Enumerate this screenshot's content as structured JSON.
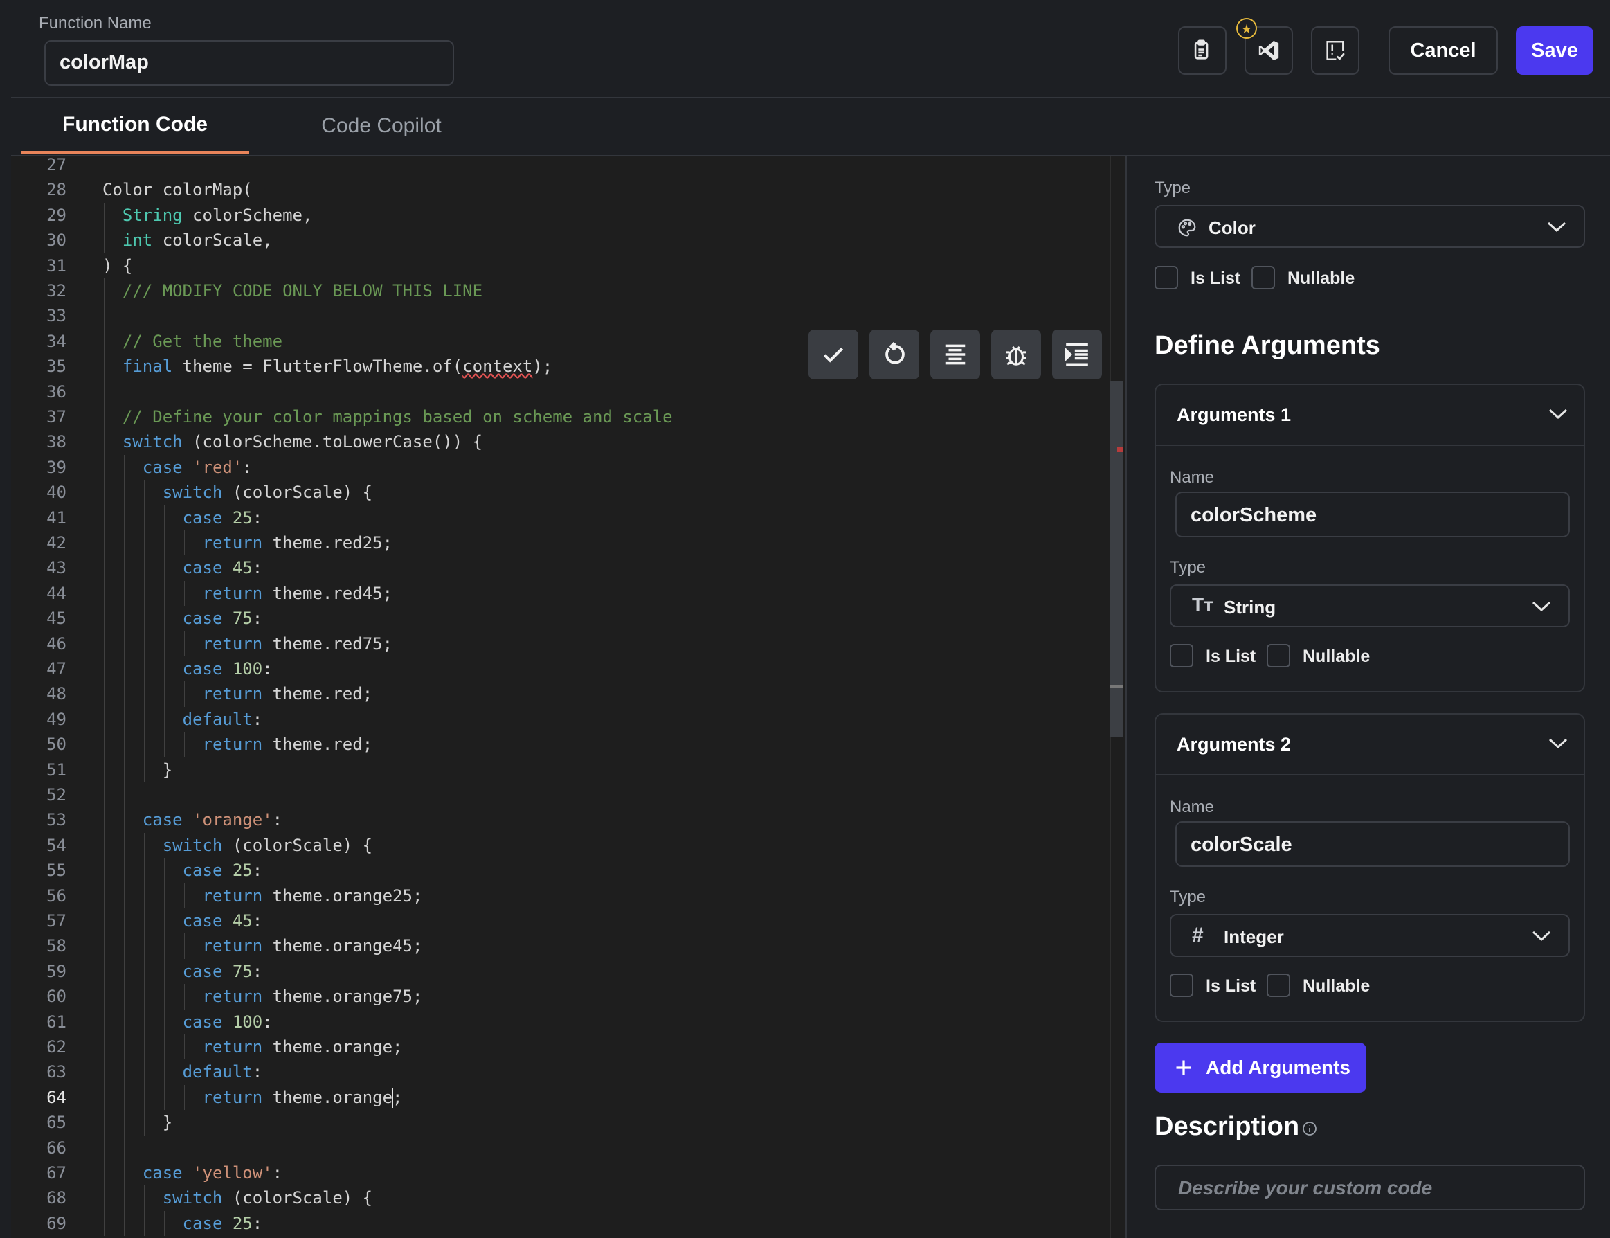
{
  "header": {
    "function_name_label": "Function Name",
    "function_name_value": "colorMap",
    "cancel_label": "Cancel",
    "save_label": "Save",
    "icons": [
      "copy-code-icon",
      "vscode-icon",
      "review-icon"
    ]
  },
  "tabs": [
    {
      "label": "Function Code",
      "active": true
    },
    {
      "label": "Code Copilot",
      "active": false
    }
  ],
  "editor": {
    "current_line": 64,
    "toolbar_icons": [
      "check-icon",
      "refresh-icon",
      "format-align-icon",
      "debug-bug-icon",
      "indent-icon"
    ],
    "lines": [
      {
        "n": 27,
        "i": 0,
        "t": []
      },
      {
        "n": 28,
        "i": 0,
        "t": [
          [
            "d",
            "Color colorMap("
          ]
        ]
      },
      {
        "n": 29,
        "i": 1,
        "t": [
          [
            "ty",
            "String"
          ],
          [
            "d",
            " colorScheme,"
          ]
        ]
      },
      {
        "n": 30,
        "i": 1,
        "t": [
          [
            "ty",
            "int"
          ],
          [
            "d",
            " colorScale,"
          ]
        ]
      },
      {
        "n": 31,
        "i": 0,
        "t": [
          [
            "d",
            ") {"
          ]
        ]
      },
      {
        "n": 32,
        "i": 1,
        "t": [
          [
            "cm",
            "/// MODIFY CODE ONLY BELOW THIS LINE"
          ]
        ]
      },
      {
        "n": 33,
        "i": 0,
        "t": []
      },
      {
        "n": 34,
        "i": 1,
        "t": [
          [
            "cm",
            "// Get the theme"
          ]
        ]
      },
      {
        "n": 35,
        "i": 1,
        "t": [
          [
            "kw",
            "final"
          ],
          [
            "d",
            " theme = FlutterFlowTheme.of("
          ],
          [
            "sq",
            "context"
          ],
          [
            "d",
            ");"
          ]
        ]
      },
      {
        "n": 36,
        "i": 0,
        "t": []
      },
      {
        "n": 37,
        "i": 1,
        "t": [
          [
            "cm",
            "// Define your color mappings based on scheme and scale"
          ]
        ]
      },
      {
        "n": 38,
        "i": 1,
        "t": [
          [
            "kw",
            "switch"
          ],
          [
            "d",
            " (colorScheme.toLowerCase()) {"
          ]
        ]
      },
      {
        "n": 39,
        "i": 2,
        "t": [
          [
            "kw",
            "case"
          ],
          [
            "d",
            " "
          ],
          [
            "st",
            "'red'"
          ],
          [
            "d",
            ":"
          ]
        ]
      },
      {
        "n": 40,
        "i": 3,
        "t": [
          [
            "kw",
            "switch"
          ],
          [
            "d",
            " (colorScale) {"
          ]
        ]
      },
      {
        "n": 41,
        "i": 4,
        "t": [
          [
            "kw",
            "case"
          ],
          [
            "d",
            " "
          ],
          [
            "nm",
            "25"
          ],
          [
            "d",
            ":"
          ]
        ]
      },
      {
        "n": 42,
        "i": 5,
        "t": [
          [
            "kw",
            "return"
          ],
          [
            "d",
            " theme.red25;"
          ]
        ]
      },
      {
        "n": 43,
        "i": 4,
        "t": [
          [
            "kw",
            "case"
          ],
          [
            "d",
            " "
          ],
          [
            "nm",
            "45"
          ],
          [
            "d",
            ":"
          ]
        ]
      },
      {
        "n": 44,
        "i": 5,
        "t": [
          [
            "kw",
            "return"
          ],
          [
            "d",
            " theme.red45;"
          ]
        ]
      },
      {
        "n": 45,
        "i": 4,
        "t": [
          [
            "kw",
            "case"
          ],
          [
            "d",
            " "
          ],
          [
            "nm",
            "75"
          ],
          [
            "d",
            ":"
          ]
        ]
      },
      {
        "n": 46,
        "i": 5,
        "t": [
          [
            "kw",
            "return"
          ],
          [
            "d",
            " theme.red75;"
          ]
        ]
      },
      {
        "n": 47,
        "i": 4,
        "t": [
          [
            "kw",
            "case"
          ],
          [
            "d",
            " "
          ],
          [
            "nm",
            "100"
          ],
          [
            "d",
            ":"
          ]
        ]
      },
      {
        "n": 48,
        "i": 5,
        "t": [
          [
            "kw",
            "return"
          ],
          [
            "d",
            " theme.red;"
          ]
        ]
      },
      {
        "n": 49,
        "i": 4,
        "t": [
          [
            "kw",
            "default"
          ],
          [
            "d",
            ":"
          ]
        ]
      },
      {
        "n": 50,
        "i": 5,
        "t": [
          [
            "kw",
            "return"
          ],
          [
            "d",
            " theme.red;"
          ]
        ]
      },
      {
        "n": 51,
        "i": 3,
        "t": [
          [
            "d",
            "}"
          ]
        ]
      },
      {
        "n": 52,
        "i": 0,
        "t": []
      },
      {
        "n": 53,
        "i": 2,
        "t": [
          [
            "kw",
            "case"
          ],
          [
            "d",
            " "
          ],
          [
            "st",
            "'orange'"
          ],
          [
            "d",
            ":"
          ]
        ]
      },
      {
        "n": 54,
        "i": 3,
        "t": [
          [
            "kw",
            "switch"
          ],
          [
            "d",
            " (colorScale) {"
          ]
        ]
      },
      {
        "n": 55,
        "i": 4,
        "t": [
          [
            "kw",
            "case"
          ],
          [
            "d",
            " "
          ],
          [
            "nm",
            "25"
          ],
          [
            "d",
            ":"
          ]
        ]
      },
      {
        "n": 56,
        "i": 5,
        "t": [
          [
            "kw",
            "return"
          ],
          [
            "d",
            " theme.orange25;"
          ]
        ]
      },
      {
        "n": 57,
        "i": 4,
        "t": [
          [
            "kw",
            "case"
          ],
          [
            "d",
            " "
          ],
          [
            "nm",
            "45"
          ],
          [
            "d",
            ":"
          ]
        ]
      },
      {
        "n": 58,
        "i": 5,
        "t": [
          [
            "kw",
            "return"
          ],
          [
            "d",
            " theme.orange45;"
          ]
        ]
      },
      {
        "n": 59,
        "i": 4,
        "t": [
          [
            "kw",
            "case"
          ],
          [
            "d",
            " "
          ],
          [
            "nm",
            "75"
          ],
          [
            "d",
            ":"
          ]
        ]
      },
      {
        "n": 60,
        "i": 5,
        "t": [
          [
            "kw",
            "return"
          ],
          [
            "d",
            " theme.orange75;"
          ]
        ]
      },
      {
        "n": 61,
        "i": 4,
        "t": [
          [
            "kw",
            "case"
          ],
          [
            "d",
            " "
          ],
          [
            "nm",
            "100"
          ],
          [
            "d",
            ":"
          ]
        ]
      },
      {
        "n": 62,
        "i": 5,
        "t": [
          [
            "kw",
            "return"
          ],
          [
            "d",
            " theme.orange;"
          ]
        ]
      },
      {
        "n": 63,
        "i": 4,
        "t": [
          [
            "kw",
            "default"
          ],
          [
            "d",
            ":"
          ]
        ]
      },
      {
        "n": 64,
        "i": 5,
        "t": [
          [
            "kw",
            "return"
          ],
          [
            "d",
            " theme.orange"
          ],
          [
            "cur",
            ""
          ],
          [
            "d",
            ";"
          ]
        ]
      },
      {
        "n": 65,
        "i": 3,
        "t": [
          [
            "d",
            "}"
          ]
        ]
      },
      {
        "n": 66,
        "i": 0,
        "t": []
      },
      {
        "n": 67,
        "i": 2,
        "t": [
          [
            "kw",
            "case"
          ],
          [
            "d",
            " "
          ],
          [
            "st",
            "'yellow'"
          ],
          [
            "d",
            ":"
          ]
        ]
      },
      {
        "n": 68,
        "i": 3,
        "t": [
          [
            "kw",
            "switch"
          ],
          [
            "d",
            " (colorScale) {"
          ]
        ]
      },
      {
        "n": 69,
        "i": 4,
        "t": [
          [
            "kw",
            "case"
          ],
          [
            "d",
            " "
          ],
          [
            "nm",
            "25"
          ],
          [
            "d",
            ":"
          ]
        ]
      }
    ]
  },
  "panel": {
    "return_type_label": "Type",
    "return_type_value": "Color",
    "is_list_label": "Is List",
    "nullable_label": "Nullable",
    "define_arguments_title": "Define Arguments",
    "arguments": [
      {
        "title": "Arguments 1",
        "name_label": "Name",
        "name_value": "colorScheme",
        "type_label": "Type",
        "type_value": "String",
        "is_list_label": "Is List",
        "nullable_label": "Nullable"
      },
      {
        "title": "Arguments 2",
        "name_label": "Name",
        "name_value": "colorScale",
        "type_label": "Type",
        "type_value": "Integer",
        "is_list_label": "Is List",
        "nullable_label": "Nullable"
      }
    ],
    "add_arguments_label": "Add Arguments",
    "description_title": "Description",
    "description_placeholder": "Describe your custom code"
  },
  "colors": {
    "accent": "#4b39ef",
    "tab_underline": "#e8845a",
    "keyword": "#569cd6",
    "type": "#4ec9b0",
    "comment": "#6a9955",
    "string": "#ce9178",
    "number": "#b5cea8"
  }
}
